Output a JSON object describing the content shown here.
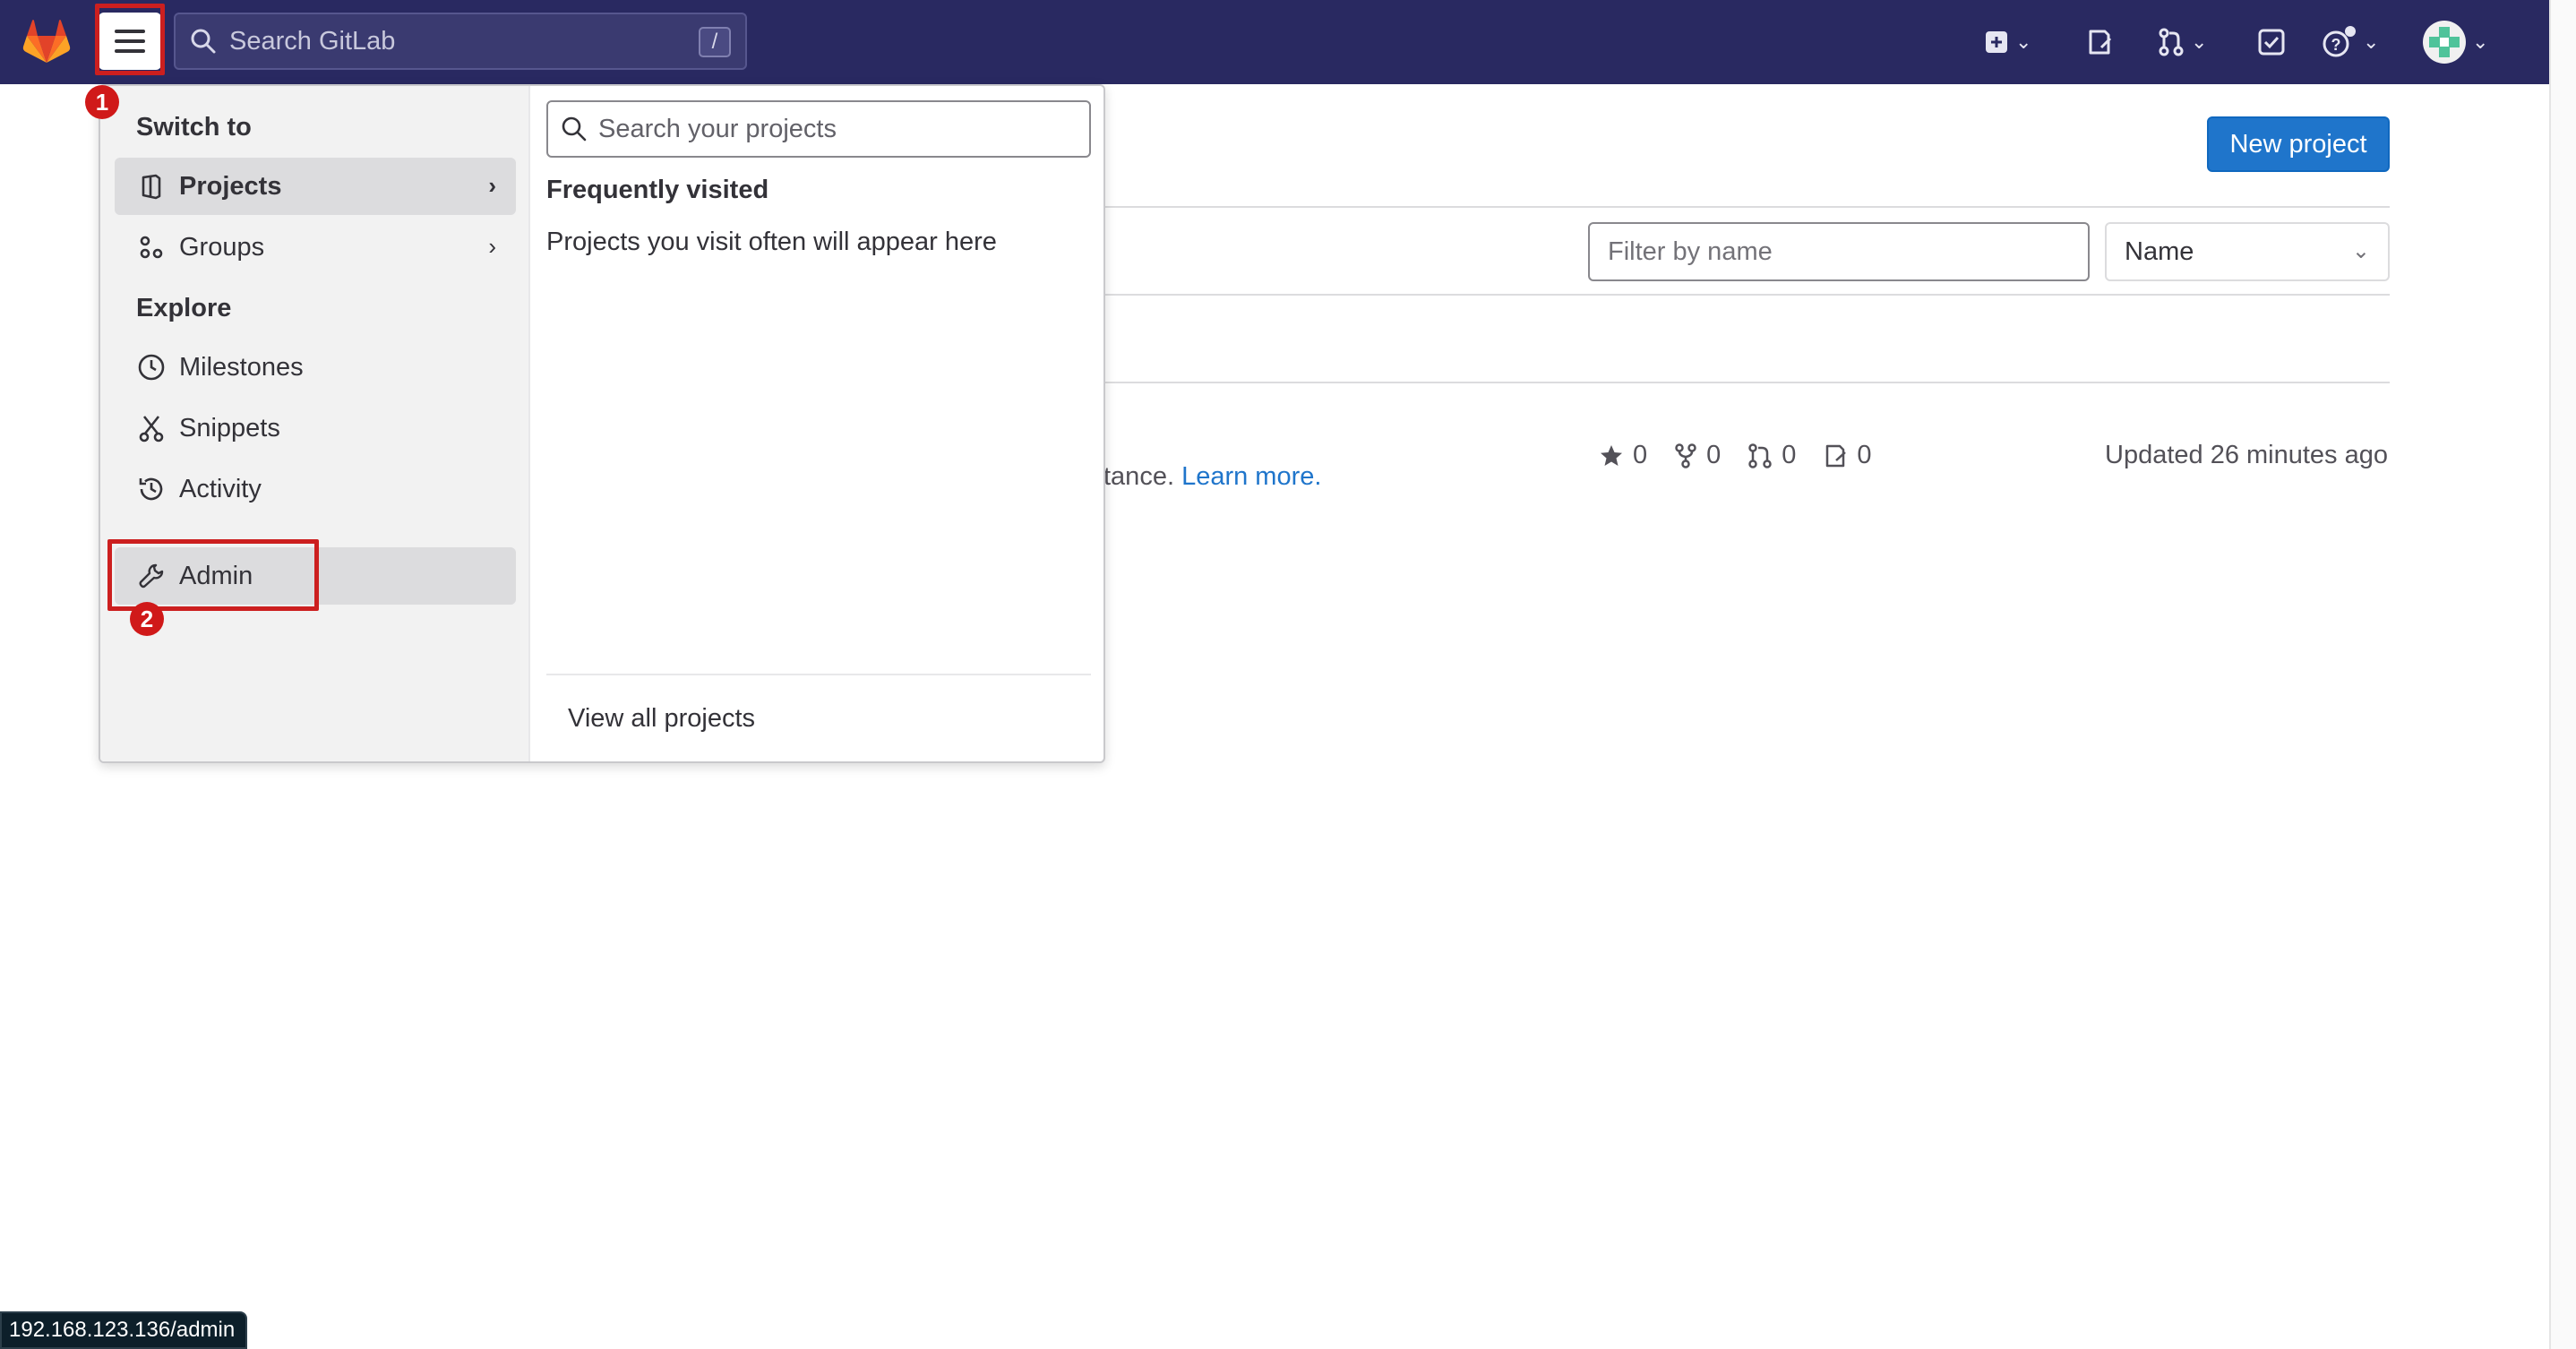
{
  "topbar": {
    "search_placeholder": "Search GitLab",
    "search_shortcut": "/",
    "icons": [
      "gitlab-logo",
      "hamburger-menu-icon",
      "search-icon",
      "create-new-icon",
      "issues-icon",
      "merge-requests-icon",
      "todo-icon",
      "help-icon",
      "avatar"
    ]
  },
  "annotations": {
    "step1": "1",
    "step2": "2"
  },
  "menu": {
    "switch_to_heading": "Switch to",
    "items": [
      {
        "label": "Projects",
        "icon": "project-icon"
      },
      {
        "label": "Groups",
        "icon": "group-icon"
      }
    ],
    "explore_heading": "Explore",
    "explore_items": [
      {
        "label": "Milestones",
        "icon": "clock-icon"
      },
      {
        "label": "Snippets",
        "icon": "snippet-icon"
      },
      {
        "label": "Activity",
        "icon": "history-icon"
      }
    ],
    "admin_label": "Admin",
    "projects_panel": {
      "search_placeholder": "Search your projects",
      "frequently_visited": "Frequently visited",
      "empty_text": "Projects you visit often will appear here",
      "view_all": "View all projects"
    }
  },
  "main": {
    "new_project": "New project",
    "filter_placeholder": "Filter by name",
    "sort_value": "Name",
    "project_row": {
      "description_fragment": "tance. ",
      "learn_more": "Learn more.",
      "stars": "0",
      "forks": "0",
      "merge_requests": "0",
      "issues": "0",
      "updated": "Updated 26 minutes ago"
    }
  },
  "status_bar": {
    "url": "192.168.123.136/admin"
  },
  "colors": {
    "topbar": "#292961",
    "accent": "#1f75cb",
    "annotation": "#cc1f1f"
  }
}
